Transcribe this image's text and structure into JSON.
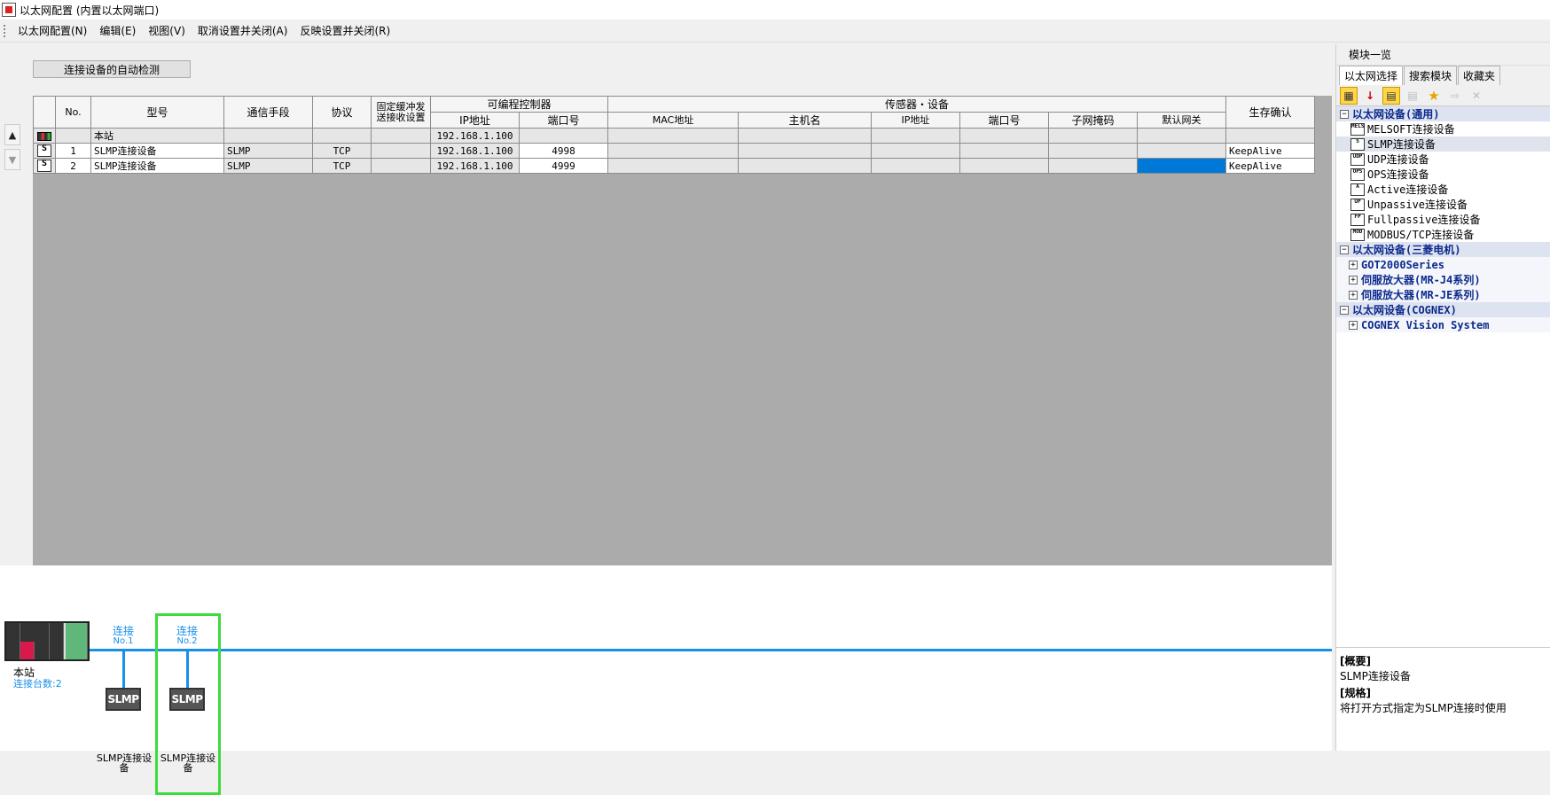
{
  "window": {
    "title": "以太网配置 (内置以太网端口)"
  },
  "menu": [
    "以太网配置(N)",
    "编辑(E)",
    "视图(V)",
    "取消设置并关闭(A)",
    "反映设置并关闭(R)"
  ],
  "toolbar": {
    "auto_detect_label": "连接设备的自动检测"
  },
  "grid": {
    "headers": {
      "no": "No.",
      "model": "型号",
      "comm_method": "通信手段",
      "protocol": "协议",
      "fixed_buffer": "固定缓冲发送接收设置",
      "plc_group": "可编程控制器",
      "plc_ip": "IP地址",
      "plc_port": "端口号",
      "sensor_group": "传感器・设备",
      "mac": "MAC地址",
      "host": "主机名",
      "dev_ip": "IP地址",
      "dev_port": "端口号",
      "subnet": "子网掩码",
      "gateway": "默认网关",
      "alive": "生存确认"
    },
    "rows": [
      {
        "icon": "station",
        "no": "",
        "model": "本站",
        "comm": "",
        "protocol": "",
        "ip": "192.168.1.100",
        "port": "",
        "alive": ""
      },
      {
        "icon": "slmp",
        "no": "1",
        "model": "SLMP连接设备",
        "comm": "SLMP",
        "protocol": "TCP",
        "ip": "192.168.1.100",
        "port": "4998",
        "alive": "KeepAlive"
      },
      {
        "icon": "slmp",
        "no": "2",
        "model": "SLMP连接设备",
        "comm": "SLMP",
        "protocol": "TCP",
        "ip": "192.168.1.100",
        "port": "4999",
        "alive": "KeepAlive"
      }
    ]
  },
  "network": {
    "station_label": "本站",
    "station_count": "连接台数:2",
    "connections": [
      {
        "label": "连接",
        "no": "No.1",
        "device": "SLMP",
        "device_label": "SLMP连接设备"
      },
      {
        "label": "连接",
        "no": "No.2",
        "device": "SLMP",
        "device_label": "SLMP连接设备"
      }
    ]
  },
  "side": {
    "title": "模块一览",
    "tabs": [
      "以太网选择",
      "搜索模块",
      "收藏夹"
    ],
    "categories": [
      {
        "label": "以太网设备(通用)",
        "items": [
          {
            "icon": "MELSOFT",
            "label": "MELSOFT连接设备"
          },
          {
            "icon": "S",
            "label": "SLMP连接设备"
          },
          {
            "icon": "UDP",
            "label": "UDP连接设备"
          },
          {
            "icon": "OPS",
            "label": "OPS连接设备"
          },
          {
            "icon": "A",
            "label": "Active连接设备"
          },
          {
            "icon": "UP",
            "label": "Unpassive连接设备"
          },
          {
            "icon": "FP",
            "label": "Fullpassive连接设备"
          },
          {
            "icon": "MOD",
            "label": "MODBUS/TCP连接设备"
          }
        ]
      },
      {
        "label": "以太网设备(三菱电机)",
        "subs": [
          "GOT2000Series",
          "伺服放大器(MR-J4系列)",
          "伺服放大器(MR-JE系列)"
        ]
      },
      {
        "label": "以太网设备(COGNEX)",
        "subs": [
          "COGNEX Vision System"
        ]
      }
    ],
    "desc": {
      "overview_h": "[概要]",
      "overview": "SLMP连接设备",
      "spec_h": "[规格]",
      "spec": "将打开方式指定为SLMP连接时使用"
    }
  }
}
